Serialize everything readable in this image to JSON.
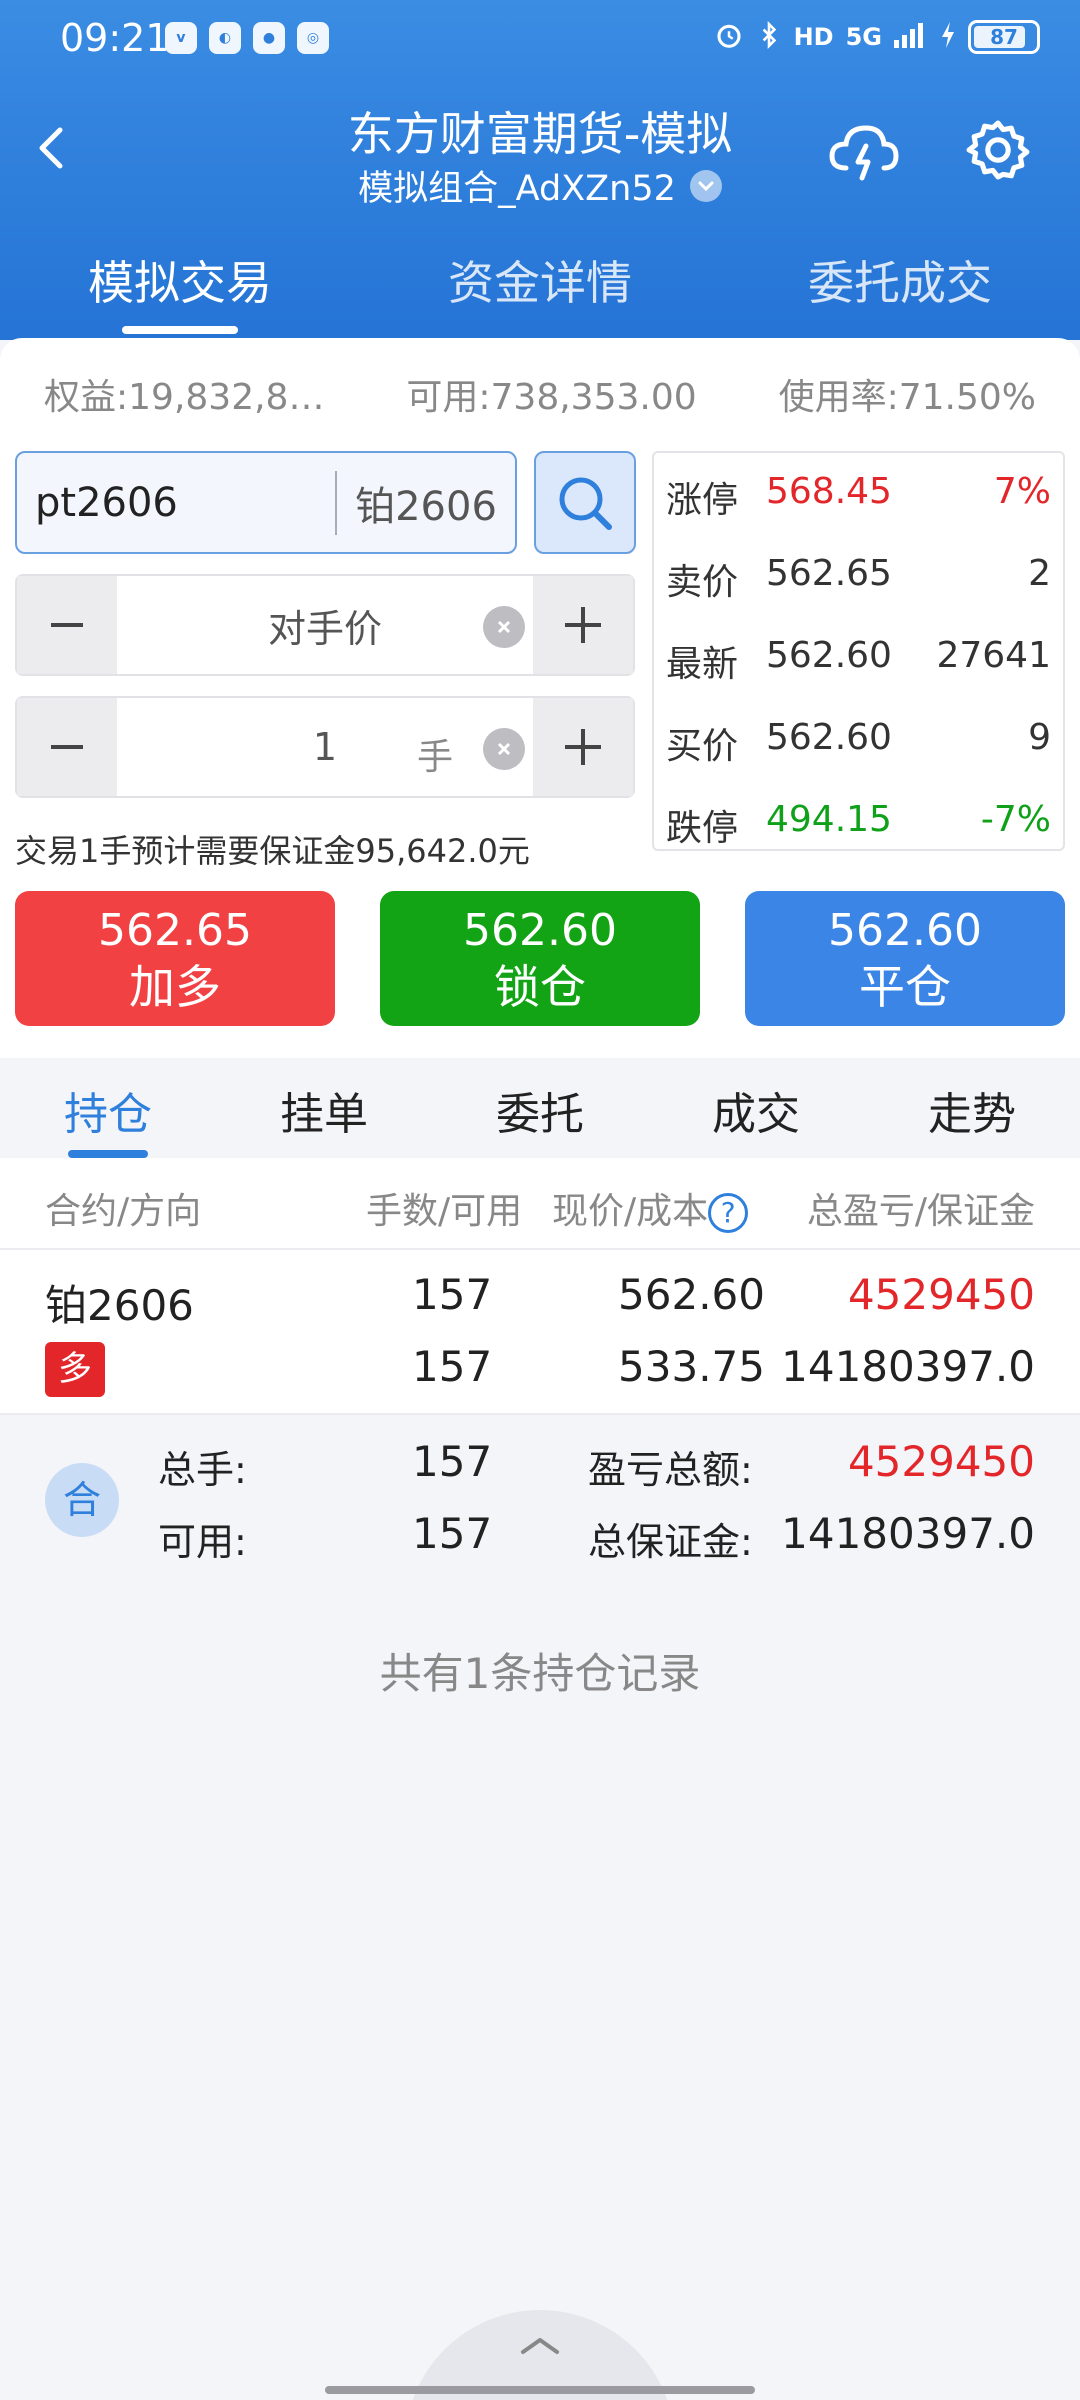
{
  "status_bar": {
    "time": "09:21",
    "network": "5G",
    "hd": "HD",
    "battery": "87",
    "battery_level": 0.87
  },
  "header": {
    "title": "东方财富期货-模拟",
    "subtitle": "模拟组合_AdXZn52",
    "tabs": [
      "模拟交易",
      "资金详情",
      "委托成交"
    ],
    "active_tab": 0
  },
  "summary": {
    "equity": "权益:19,832,8…",
    "available": "可用:738,353.00",
    "usage": "使用率:71.50%"
  },
  "order_form": {
    "code": "pt2606",
    "name": "铂2606",
    "price_mode": "对手价",
    "quantity": "1",
    "quantity_unit": "手",
    "margin_note": "交易1手预计需要保证金95,642.0元"
  },
  "quote": {
    "limit_up": {
      "label": "涨停",
      "price": "568.45",
      "value": "7%"
    },
    "ask": {
      "label": "卖价",
      "price": "562.65",
      "value": "2"
    },
    "last": {
      "label": "最新",
      "price": "562.60",
      "value": "27641"
    },
    "bid": {
      "label": "买价",
      "price": "562.60",
      "value": "9"
    },
    "limit_down": {
      "label": "跌停",
      "price": "494.15",
      "value": "-7%"
    }
  },
  "actions": {
    "long": {
      "price": "562.65",
      "label": "加多"
    },
    "lock": {
      "price": "562.60",
      "label": "锁仓"
    },
    "close": {
      "price": "562.60",
      "label": "平仓"
    }
  },
  "position_tabs": [
    "持仓",
    "挂单",
    "委托",
    "成交",
    "走势"
  ],
  "position_table": {
    "headers": [
      "合约/方向",
      "手数/可用",
      "现价/成本",
      "总盈亏/保证金"
    ],
    "help_icon": "?",
    "rows": [
      {
        "name": "铂2606",
        "direction": "多",
        "lots": "157",
        "available": "157",
        "current_price": "562.60",
        "cost": "533.75",
        "pnl": "4529450",
        "margin": "14180397.0"
      }
    ]
  },
  "totals": {
    "badge": "合",
    "total_lots_label": "总手:",
    "total_lots": "157",
    "available_label": "可用:",
    "available": "157",
    "pnl_label": "盈亏总额:",
    "pnl": "4529450",
    "margin_label": "总保证金:",
    "margin": "14180397.0"
  },
  "record_note": "共有1条持仓记录",
  "colors": {
    "primary": "#2f7fdc",
    "up": "#e3262a",
    "down": "#0fa11a",
    "long_btn": "#f24142",
    "lock_btn": "#12a414",
    "close_btn": "#3a85e6"
  }
}
